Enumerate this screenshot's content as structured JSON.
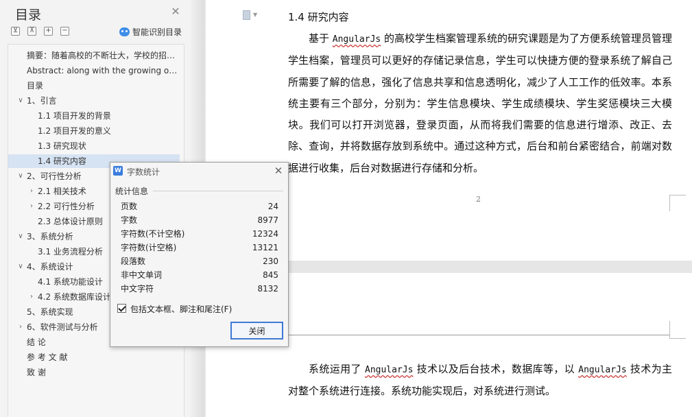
{
  "toc": {
    "title": "目录",
    "close_icon": "close-icon",
    "toolbar": {
      "expand_all": "⊻",
      "collapse_all": "⊼",
      "add": "+",
      "remove": "−",
      "smart_label": "智能识别目录"
    },
    "items": [
      {
        "label": "摘要：随着高校的不断壮大，学校的招生人数也越来越多，学校…",
        "level": 0,
        "arrow": ""
      },
      {
        "label": "Abstract: along with the growing of universities, the number of …",
        "level": 0,
        "arrow": ""
      },
      {
        "label": "目录",
        "level": 0,
        "arrow": ""
      },
      {
        "label": "1、引言",
        "level": 0,
        "arrow": "∨"
      },
      {
        "label": "1.1 项目开发的背景",
        "level": 1,
        "arrow": ""
      },
      {
        "label": "1.2 项目开发的意义",
        "level": 1,
        "arrow": ""
      },
      {
        "label": "1.3 研究现状",
        "level": 1,
        "arrow": ""
      },
      {
        "label": "1.4 研究内容",
        "level": 1,
        "arrow": "",
        "selected": true
      },
      {
        "label": "2、可行性分析",
        "level": 0,
        "arrow": "∨"
      },
      {
        "label": "2.1 相关技术",
        "level": 1,
        "arrow": "›"
      },
      {
        "label": "2.2 可行性分析",
        "level": 1,
        "arrow": "›"
      },
      {
        "label": "2.3 总体设计原则",
        "level": 1,
        "arrow": ""
      },
      {
        "label": "3、系统分析",
        "level": 0,
        "arrow": "∨"
      },
      {
        "label": "3.1 业务流程分析",
        "level": 1,
        "arrow": ""
      },
      {
        "label": "4、系统设计",
        "level": 0,
        "arrow": "∨"
      },
      {
        "label": "4.1 系统功能设计",
        "level": 1,
        "arrow": ""
      },
      {
        "label": "4.2 系统数据库设计",
        "level": 1,
        "arrow": "›"
      },
      {
        "label": "5、系统实现",
        "level": 0,
        "arrow": ""
      },
      {
        "label": "6、软件测试与分析",
        "level": 0,
        "arrow": "›"
      },
      {
        "label": "结  论",
        "level": 0,
        "arrow": ""
      },
      {
        "label": "参 考 文 献",
        "level": 0,
        "arrow": ""
      },
      {
        "label": "致  谢",
        "level": 0,
        "arrow": ""
      }
    ]
  },
  "document": {
    "heading": "1.4 研究内容",
    "p1_pre": "基于 ",
    "p1_term": "AngularJs",
    "p1_post": " 的高校学生档案管理系统的研究课题是为了方便系统管理员管理学生档案，管理员可以更好的存储记录信息，学生可以快捷方便的登录系统了解自己所需要了解的信息，强化了信息共享和信息透明化，减少了人工工作的低效率。本系统主要有三个部分，分别为：学生信息模块、学生成绩模块、学生奖惩模块三大模块。我们可以打开浏览器，登录页面，从而将我们需要的信息进行增添、改正、去除、查询，并将数据存放到系统中。通过这种方式，后台和前台紧密结合，前端对数据进行收集，后台对数据进行存储和分析。",
    "page_number": "2",
    "p2_a": "系统运用了 ",
    "p2_term1": "AngularJs",
    "p2_b": " 技术以及后台技术，数据库等，以 ",
    "p2_term2": "AngularJs",
    "p2_c": " 技术为主对整个系统进行连接。系统功能实现后，对系统进行测试。"
  },
  "word_count": {
    "title": "字数统计",
    "group_label": "统计信息",
    "stats": [
      {
        "label": "页数",
        "value": "24"
      },
      {
        "label": "字数",
        "value": "8977"
      },
      {
        "label": "字符数(不计空格)",
        "value": "12324"
      },
      {
        "label": "字符数(计空格)",
        "value": "13121"
      },
      {
        "label": "段落数",
        "value": "230"
      },
      {
        "label": "非中文单词",
        "value": "845"
      },
      {
        "label": "中文字符",
        "value": "8132"
      }
    ],
    "include_checkbox_label": "包括文本框、脚注和尾注(F)",
    "include_checked": true,
    "close_button": "关闭"
  }
}
